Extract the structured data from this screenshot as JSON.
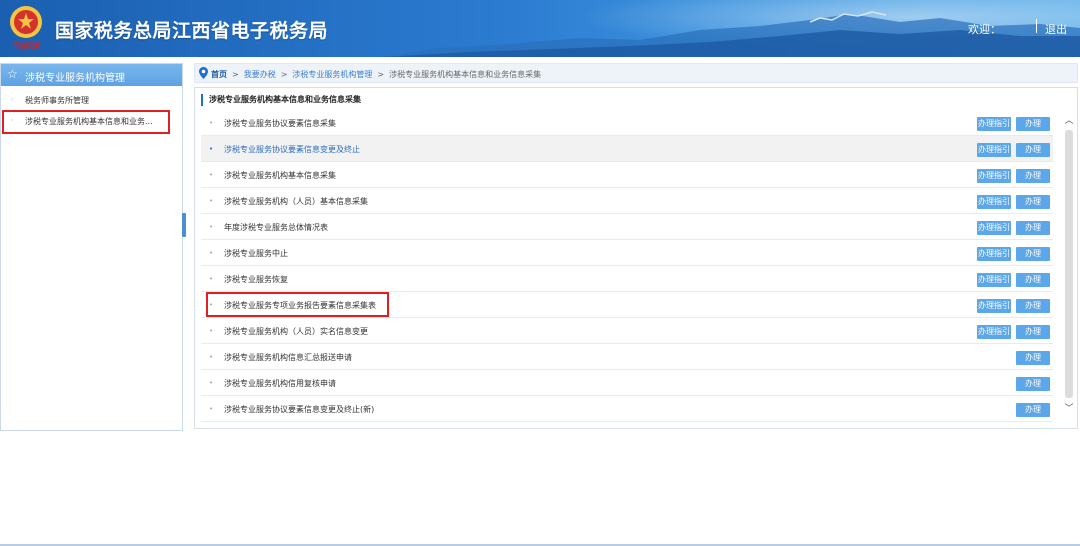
{
  "header": {
    "title": "国家税务总局江西省电子税务局",
    "emblem_caption": "中国税务",
    "welcome": "欢迎：",
    "logout": "退出"
  },
  "sidebar": {
    "title": "涉税专业服务机构管理",
    "items": [
      {
        "label": "税务师事务所管理"
      },
      {
        "label": "涉税专业服务机构基本信息和业务..."
      }
    ]
  },
  "breadcrumb": {
    "home": "首页",
    "sep": ">",
    "crumb1": "我要办税",
    "crumb2": "涉税专业服务机构管理",
    "current": "涉税专业服务机构基本信息和业务信息采集"
  },
  "panel": {
    "title": "涉税专业服务机构基本信息和业务信息采集",
    "guide_label": "办理指引",
    "do_label": "办理",
    "rows": [
      {
        "label": "涉税专业服务协议要素信息采集"
      },
      {
        "label": "涉税专业服务协议要素信息变更及终止"
      },
      {
        "label": "涉税专业服务机构基本信息采集"
      },
      {
        "label": "涉税专业服务机构（人员）基本信息采集"
      },
      {
        "label": "年度涉税专业服务总体情况表"
      },
      {
        "label": "涉税专业服务中止"
      },
      {
        "label": "涉税专业服务恢复"
      },
      {
        "label": "涉税专业服务专项业务报告要素信息采集表"
      },
      {
        "label": "涉税专业服务机构（人员）实名信息变更"
      },
      {
        "label": "涉税专业服务机构信息汇总报送申请"
      },
      {
        "label": "涉税专业服务机构信用复核申请"
      },
      {
        "label": "涉税专业服务协议要素信息变更及终止(新)"
      }
    ]
  },
  "colors": {
    "header_blue": "#1b5fb0",
    "button_blue": "#5ca6ea",
    "highlight_red": "#e02020",
    "link_blue": "#2a6cc4"
  }
}
